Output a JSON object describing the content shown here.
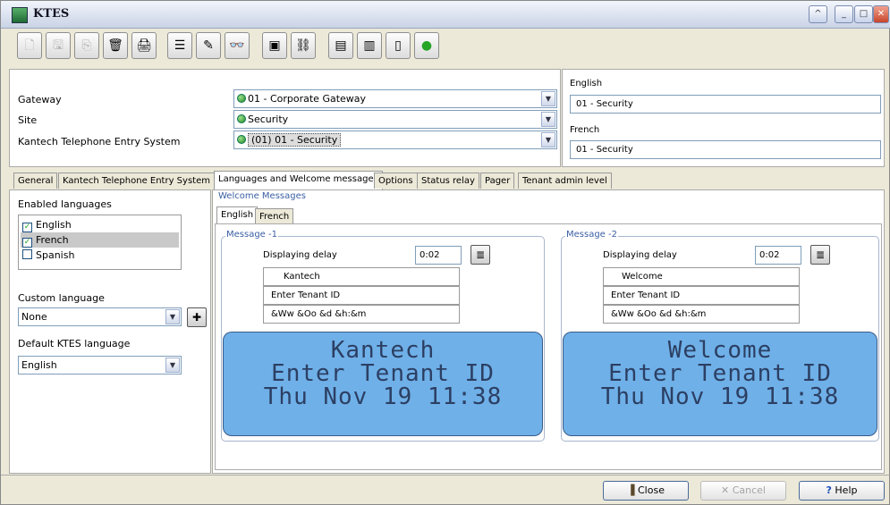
{
  "window": {
    "title": "KTES"
  },
  "titlebar_buttons": [
    "^",
    "_",
    "□",
    "✕"
  ],
  "toolbar": {
    "icons": [
      {
        "name": "new-icon",
        "glyph": "🗋"
      },
      {
        "name": "save-icon",
        "glyph": "🖫"
      },
      {
        "name": "copy-icon",
        "glyph": "⎘"
      },
      {
        "name": "delete-icon",
        "glyph": "🗑"
      },
      {
        "name": "print-icon",
        "glyph": "🖨"
      },
      {
        "name": "list-icon",
        "glyph": "☰"
      },
      {
        "name": "edit-icon",
        "glyph": "✎"
      },
      {
        "name": "find-icon",
        "glyph": "👓"
      },
      {
        "name": "report-icon",
        "glyph": "▣"
      },
      {
        "name": "link-icon",
        "glyph": "⛓"
      },
      {
        "name": "door-icon",
        "glyph": "▤"
      },
      {
        "name": "panel-icon",
        "glyph": "▥"
      },
      {
        "name": "status-icon",
        "glyph": "▯"
      },
      {
        "name": "green-status-icon",
        "glyph": "●"
      }
    ]
  },
  "header": {
    "gateway_label": "Gateway",
    "gateway_value": "01 - Corporate Gateway",
    "site_label": "Site",
    "site_value": "Security",
    "ktes_label": "Kantech Telephone Entry System",
    "ktes_value": "(01) 01 - Security",
    "english_label": "English",
    "english_value": "01 - Security",
    "french_label": "French",
    "french_value": "01 - Security"
  },
  "tabs": [
    "General",
    "Kantech Telephone Entry System",
    "Languages and Welcome messages",
    "Options",
    "Status relay",
    "Pager",
    "Tenant admin level"
  ],
  "left": {
    "enabled_label": "Enabled languages",
    "languages": [
      {
        "label": "English",
        "checked": true
      },
      {
        "label": "French",
        "checked": true
      },
      {
        "label": "Spanish",
        "checked": false
      }
    ],
    "custom_label": "Custom language",
    "custom_value": "None",
    "default_label": "Default KTES language",
    "default_value": "English"
  },
  "welcome": {
    "title": "Welcome Messages",
    "subtabs": [
      "English",
      "French"
    ],
    "delay_label": "Displaying delay",
    "messages": [
      {
        "title": "Message -1",
        "delay": "0:02",
        "lines": [
          "Kantech",
          "Enter Tenant ID",
          "&Ww &Oo &d &h:&m"
        ],
        "lcd": [
          "Kantech",
          "Enter Tenant ID",
          "Thu Nov 19 11:38"
        ]
      },
      {
        "title": "Message -2",
        "delay": "0:02",
        "lines": [
          "Welcome",
          "Enter Tenant ID",
          "&Ww &Oo &d &h:&m"
        ],
        "lcd": [
          "Welcome",
          "Enter Tenant ID",
          "Thu Nov 19 11:38"
        ]
      }
    ]
  },
  "footer": {
    "close": "Close",
    "cancel": "Cancel",
    "help": "Help"
  },
  "colors": {
    "lcd": "#6fb0e8",
    "accent": "#3a5fa3"
  }
}
